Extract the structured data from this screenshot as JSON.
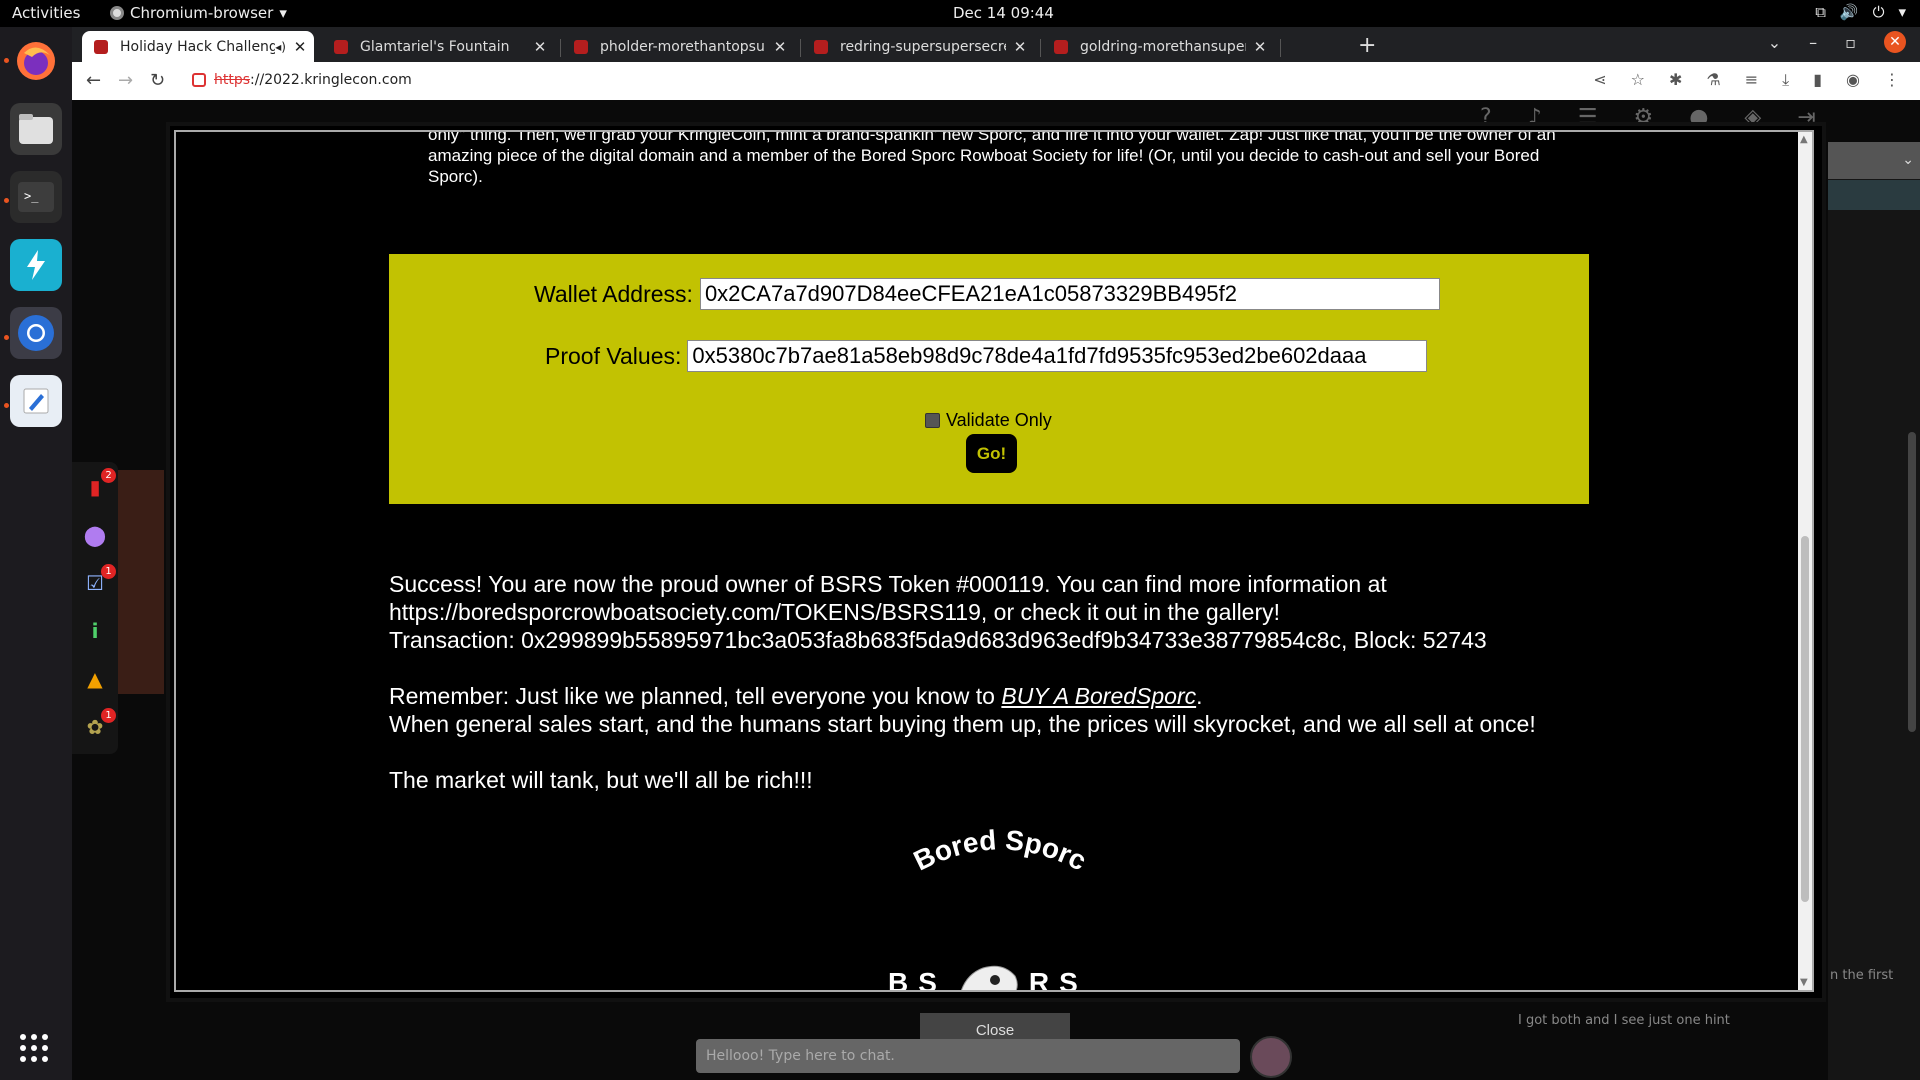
{
  "topbar": {
    "activities": "Activities",
    "app_name": "Chromium-browser",
    "clock": "Dec 14  09:44"
  },
  "browser": {
    "tabs": [
      {
        "title": "Holiday Hack Challeng",
        "active": true
      },
      {
        "title": "Glamtariel's Fountain",
        "active": false
      },
      {
        "title": "pholder-morethantopsup",
        "active": false
      },
      {
        "title": "redring-supersupersecret",
        "active": false
      },
      {
        "title": "goldring-morethansupert",
        "active": false
      }
    ],
    "url_scheme": "https",
    "url_rest": "://2022.kringlecon.com"
  },
  "modal": {
    "intro_text": "only\" thing. Then, we'll grab your KringleCoin, mint a brand-spankin' new Sporc, and fire it into your wallet. Zap! Just like that, you'll be the owner of an amazing piece of the digital domain and a member of the Bored Sporc Rowboat Society for life! (Or, until you decide to cash-out and sell your Bored Sporc).",
    "form": {
      "wallet_label": "Wallet Address:",
      "wallet_value": "0x2CA7a7d907D84eeCFEA21eA1c05873329BB495f2",
      "proof_label": "Proof Values:",
      "proof_value": "0x5380c7b7ae81a58eb98d9c78de4a1fd7fd9535fc953ed2be602daaa",
      "validate_label": "Validate Only",
      "go_label": "Go!"
    },
    "result": {
      "line1": "Success! You are now the proud owner of BSRS Token #000119. You can find more information at",
      "line2": "https://boredsporcrowboatsociety.com/TOKENS/BSRS119, or check it out in the gallery!",
      "line3": "Transaction: 0x299899b55895971bc3a053fa8b683f5da9d683d963edf9b34733e38779854c8c, Block: 52743",
      "remember_prefix": "Remember: Just like we planned, tell everyone you know to ",
      "remember_link": "BUY A BoredSporc",
      "remember_suffix": ".",
      "line5": "When general sales start, and the humans start buying them up, the prices will skyrocket, and we all sell at once!",
      "line6": "The market will tank, but we'll all be rich!!!"
    },
    "logo": {
      "arc_text": "Bored Sporc",
      "left_letters": "BS",
      "right_letters": "RS"
    },
    "close_label": "Close"
  },
  "sidebar_badges": {
    "book": "2",
    "objectives": "1",
    "achievements": "1"
  },
  "chat": {
    "placeholder": "Hellooo! Type here to chat.",
    "msg_partial": "n the first",
    "msg": "I got both and I see just one hint"
  }
}
